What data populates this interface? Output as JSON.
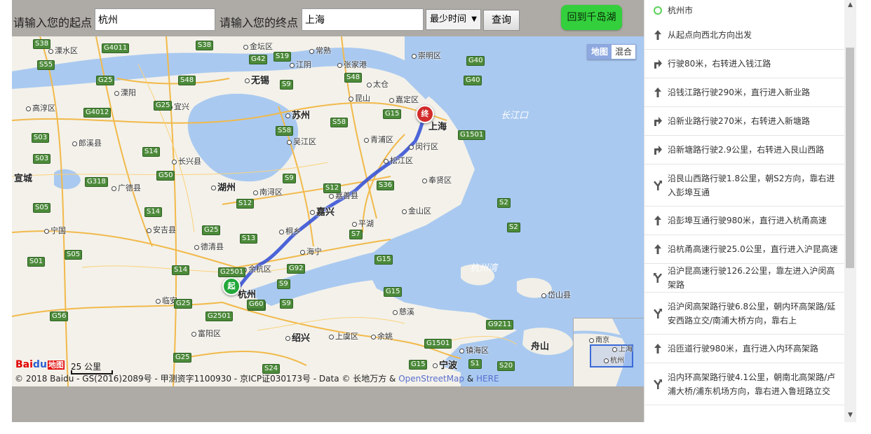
{
  "toolbar": {
    "start_label": "请输入您的起点",
    "start_value": "杭州",
    "end_label": "请输入您的终点",
    "end_value": "上海",
    "strategy_value": "最少时间",
    "search_label": "查询",
    "back_label": "回到千岛湖"
  },
  "map": {
    "type_buttons": [
      "地图",
      "混合"
    ],
    "active_type": "地图",
    "scale_label": "25 公里",
    "copyright_text": "© 2018 Baidu - GS(2016)2089号 - 甲测资字1100930 - 京ICP证030173号 - Data © 长地万方 & ",
    "link_osm": "OpenStreetMap",
    "link_sep": " & ",
    "link_here": "HERE",
    "logo_text": "Bai",
    "logo_paw": "du",
    "logo_ditu": "地图",
    "start_marker": "起",
    "end_marker": "终",
    "route_color": "#3a54d6",
    "water_color": "#a9c9f0",
    "places": {
      "wuxi": "无锡",
      "suzhou": "苏州",
      "shanghai": "上海",
      "huzhou": "湖州",
      "jiaxing": "嘉兴",
      "hangzhou": "杭州",
      "shaoxing": "绍兴",
      "ningbo": "宁波",
      "zhoushan": "舟山",
      "xuancheng": "宣城",
      "changjiangkou": "长江口",
      "hangzhouwan": "杭州湾",
      "liyang": "溧阳",
      "yixing": "宜兴",
      "changshu": "常熟",
      "kunshan": "昆山",
      "taicang": "太仓",
      "jiading": "嘉定区",
      "chongming": "崇明区",
      "qingpu": "青浦区",
      "songjiang": "松江区",
      "minhang": "闵行区",
      "fengxian": "奉贤区",
      "jinshan": "金山区",
      "pinghu": "平湖",
      "haining": "海宁",
      "tongxiang": "桐乡",
      "deqing": "德清县",
      "anji": "安吉县",
      "changxing": "长兴县",
      "nanxun": "南浔区",
      "wujiang": "吴江区",
      "jiashan": "嘉善县",
      "yuhang": "余杭区",
      "lin_an": "临安",
      "fuyang": "富阳区",
      "shangyu": "上虞区",
      "yuyao": "余姚",
      "cixi": "慈溪",
      "zhenhai": "镇海区",
      "daishan": "岱山县",
      "guangde": "广德县",
      "ningguo": "宁国",
      "langxi": "郎溪县",
      "gaochun": "高淳区",
      "lishui": "溧水区",
      "jintan": "金坛区",
      "jiangyin": "江阴",
      "zhangjiagang": "张家港",
      "ov_nanjing": "南京",
      "ov_shanghai": "上海",
      "ov_hangzhou": "杭州"
    },
    "roads": [
      "S38",
      "G4011",
      "S55",
      "S38",
      "G42",
      "S19",
      "G25",
      "S48",
      "S9",
      "S48",
      "G40",
      "G40",
      "S58",
      "G4012",
      "G25",
      "G15",
      "G1501",
      "S58",
      "S03",
      "S14",
      "G50",
      "S9",
      "S03",
      "G318",
      "S12",
      "S36",
      "S12",
      "S05",
      "S14",
      "G25",
      "S7",
      "S2",
      "S2",
      "S13",
      "G60",
      "G2501",
      "G92",
      "S01",
      "S05",
      "S14",
      "S9",
      "G15",
      "G56",
      "G25",
      "G60",
      "S9",
      "G2501",
      "G15",
      "G9211",
      "G1501",
      "G25",
      "S24",
      "G15",
      "S1",
      "S20"
    ]
  },
  "directions": {
    "steps": [
      {
        "text": "杭州市",
        "icon": "start-circle-icon"
      },
      {
        "text": "从起点向西北方向出发",
        "icon": "arrow-up-icon"
      },
      {
        "text": "行驶80米，右转进入钱江路",
        "icon": "turn-right-icon"
      },
      {
        "text": "沿钱江路行驶290米，直行进入新业路",
        "icon": "arrow-up-icon"
      },
      {
        "text": "沿新业路行驶270米，右转进入新塘路",
        "icon": "turn-right-icon"
      },
      {
        "text": "沿新塘路行驶2.9公里，右转进入艮山西路",
        "icon": "turn-right-icon"
      },
      {
        "text": "沿艮山西路行驶1.8公里，朝S2方向，靠右进入彭埠互通",
        "icon": "keep-right-icon"
      },
      {
        "text": "沿彭埠互通行驶980米，直行进入杭甬高速",
        "icon": "arrow-up-icon"
      },
      {
        "text": "沿杭甬高速行驶25.0公里，直行进入沪昆高速",
        "icon": "arrow-up-icon"
      },
      {
        "text": "沿沪昆高速行驶126.2公里，靠左进入沪闵高架路",
        "icon": "keep-left-icon"
      },
      {
        "text": "沿沪闵高架路行驶6.8公里，朝内环高架路/延安西路立交/南浦大桥方向，靠右上",
        "icon": "keep-right-icon"
      },
      {
        "text": "沿匝道行驶980米，直行进入内环高架路",
        "icon": "arrow-up-icon"
      },
      {
        "text": "沿内环高架路行驶4.1公里，朝南北高架路/卢浦大桥/浦东机场方向，靠右进入鲁班路立交",
        "icon": "keep-right-icon"
      }
    ]
  }
}
